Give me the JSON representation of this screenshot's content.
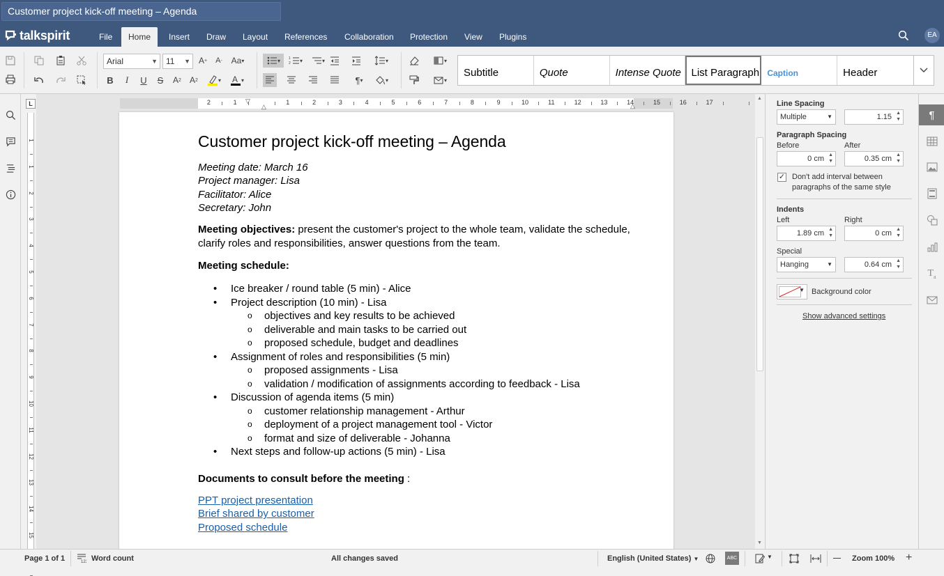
{
  "title_bar": {
    "doc_title": "Customer project kick-off meeting – Agenda"
  },
  "brand": {
    "logo_text": "talkspirit"
  },
  "menu": {
    "tabs": [
      "File",
      "Home",
      "Insert",
      "Draw",
      "Layout",
      "References",
      "Collaboration",
      "Protection",
      "View",
      "Plugins"
    ],
    "active": "Home",
    "user_initials": "EA"
  },
  "toolbar": {
    "font_name": "Arial",
    "font_size": "11",
    "styles": [
      "Subtitle",
      "Quote",
      "Intense Quote",
      "List Paragraph",
      "Caption",
      "Header"
    ],
    "selected_style": "List Paragraph"
  },
  "document": {
    "title": "Customer project kick-off meeting – Agenda",
    "meta": [
      "Meeting date: March 16",
      "Project manager: Lisa",
      "Facilitator: Alice",
      "Secretary: John"
    ],
    "objectives_label": "Meeting objectives:",
    "objectives_text": " present the customer's project to the whole team, validate the schedule, clarify roles and responsibilities, answer questions from the team.",
    "schedule_label": "Meeting schedule:",
    "schedule": [
      {
        "text": "Ice breaker / round table (5 min) - Alice",
        "sub": []
      },
      {
        "text": "Project description (10 min) - Lisa",
        "sub": [
          "objectives and key results to be achieved",
          "deliverable and main tasks to be carried out",
          "proposed schedule, budget and deadlines"
        ]
      },
      {
        "text": "Assignment of roles and responsibilities (5 min)",
        "sub": [
          "proposed assignments - Lisa",
          "validation / modification of assignments according to feedback - Lisa"
        ]
      },
      {
        "text": "Discussion of agenda items (5 min)",
        "sub": [
          "customer relationship management - Arthur",
          "deployment of a project management tool - Victor",
          "format and size of deliverable - Johanna"
        ]
      },
      {
        "text": "Next steps and follow-up actions (5 min) - Lisa",
        "sub": []
      }
    ],
    "docs_label": "Documents to consult before the meeting",
    "docs_suffix": " :",
    "links": [
      "PPT project presentation",
      "Brief shared by customer",
      "Proposed schedule"
    ]
  },
  "ruler": {
    "h_ticks": [
      "2",
      "1",
      "1",
      "2",
      "3",
      "4",
      "5",
      "6",
      "7",
      "8",
      "9",
      "10",
      "11",
      "12",
      "13",
      "14",
      "15",
      "16",
      "17"
    ],
    "v_ticks": [
      "1",
      "1",
      "2",
      "3",
      "4",
      "5",
      "6",
      "7",
      "8",
      "9",
      "10",
      "11",
      "12",
      "13",
      "14",
      "15",
      "16"
    ]
  },
  "paragraph_panel": {
    "line_spacing_label": "Line Spacing",
    "line_spacing_mode": "Multiple",
    "line_spacing_value": "1.15",
    "paragraph_spacing_label": "Paragraph Spacing",
    "before_label": "Before",
    "before_value": "0 cm",
    "after_label": "After",
    "after_value": "0.35 cm",
    "no_interval_label": "Don't add interval between paragraphs of the same style",
    "no_interval_checked": true,
    "indents_label": "Indents",
    "left_label": "Left",
    "left_value": "1.89 cm",
    "right_label": "Right",
    "right_value": "0 cm",
    "special_label": "Special",
    "special_mode": "Hanging",
    "special_value": "0.64 cm",
    "background_label": "Background color",
    "advanced_link": "Show advanced settings"
  },
  "status": {
    "page": "Page 1 of 1",
    "word_count": "Word count",
    "saved": "All changes saved",
    "language": "English (United States)",
    "zoom": "Zoom 100%"
  },
  "colors": {
    "header_bg": "#3e587e",
    "link": "#1a5fa8",
    "caption_style": "#4a90d9"
  }
}
